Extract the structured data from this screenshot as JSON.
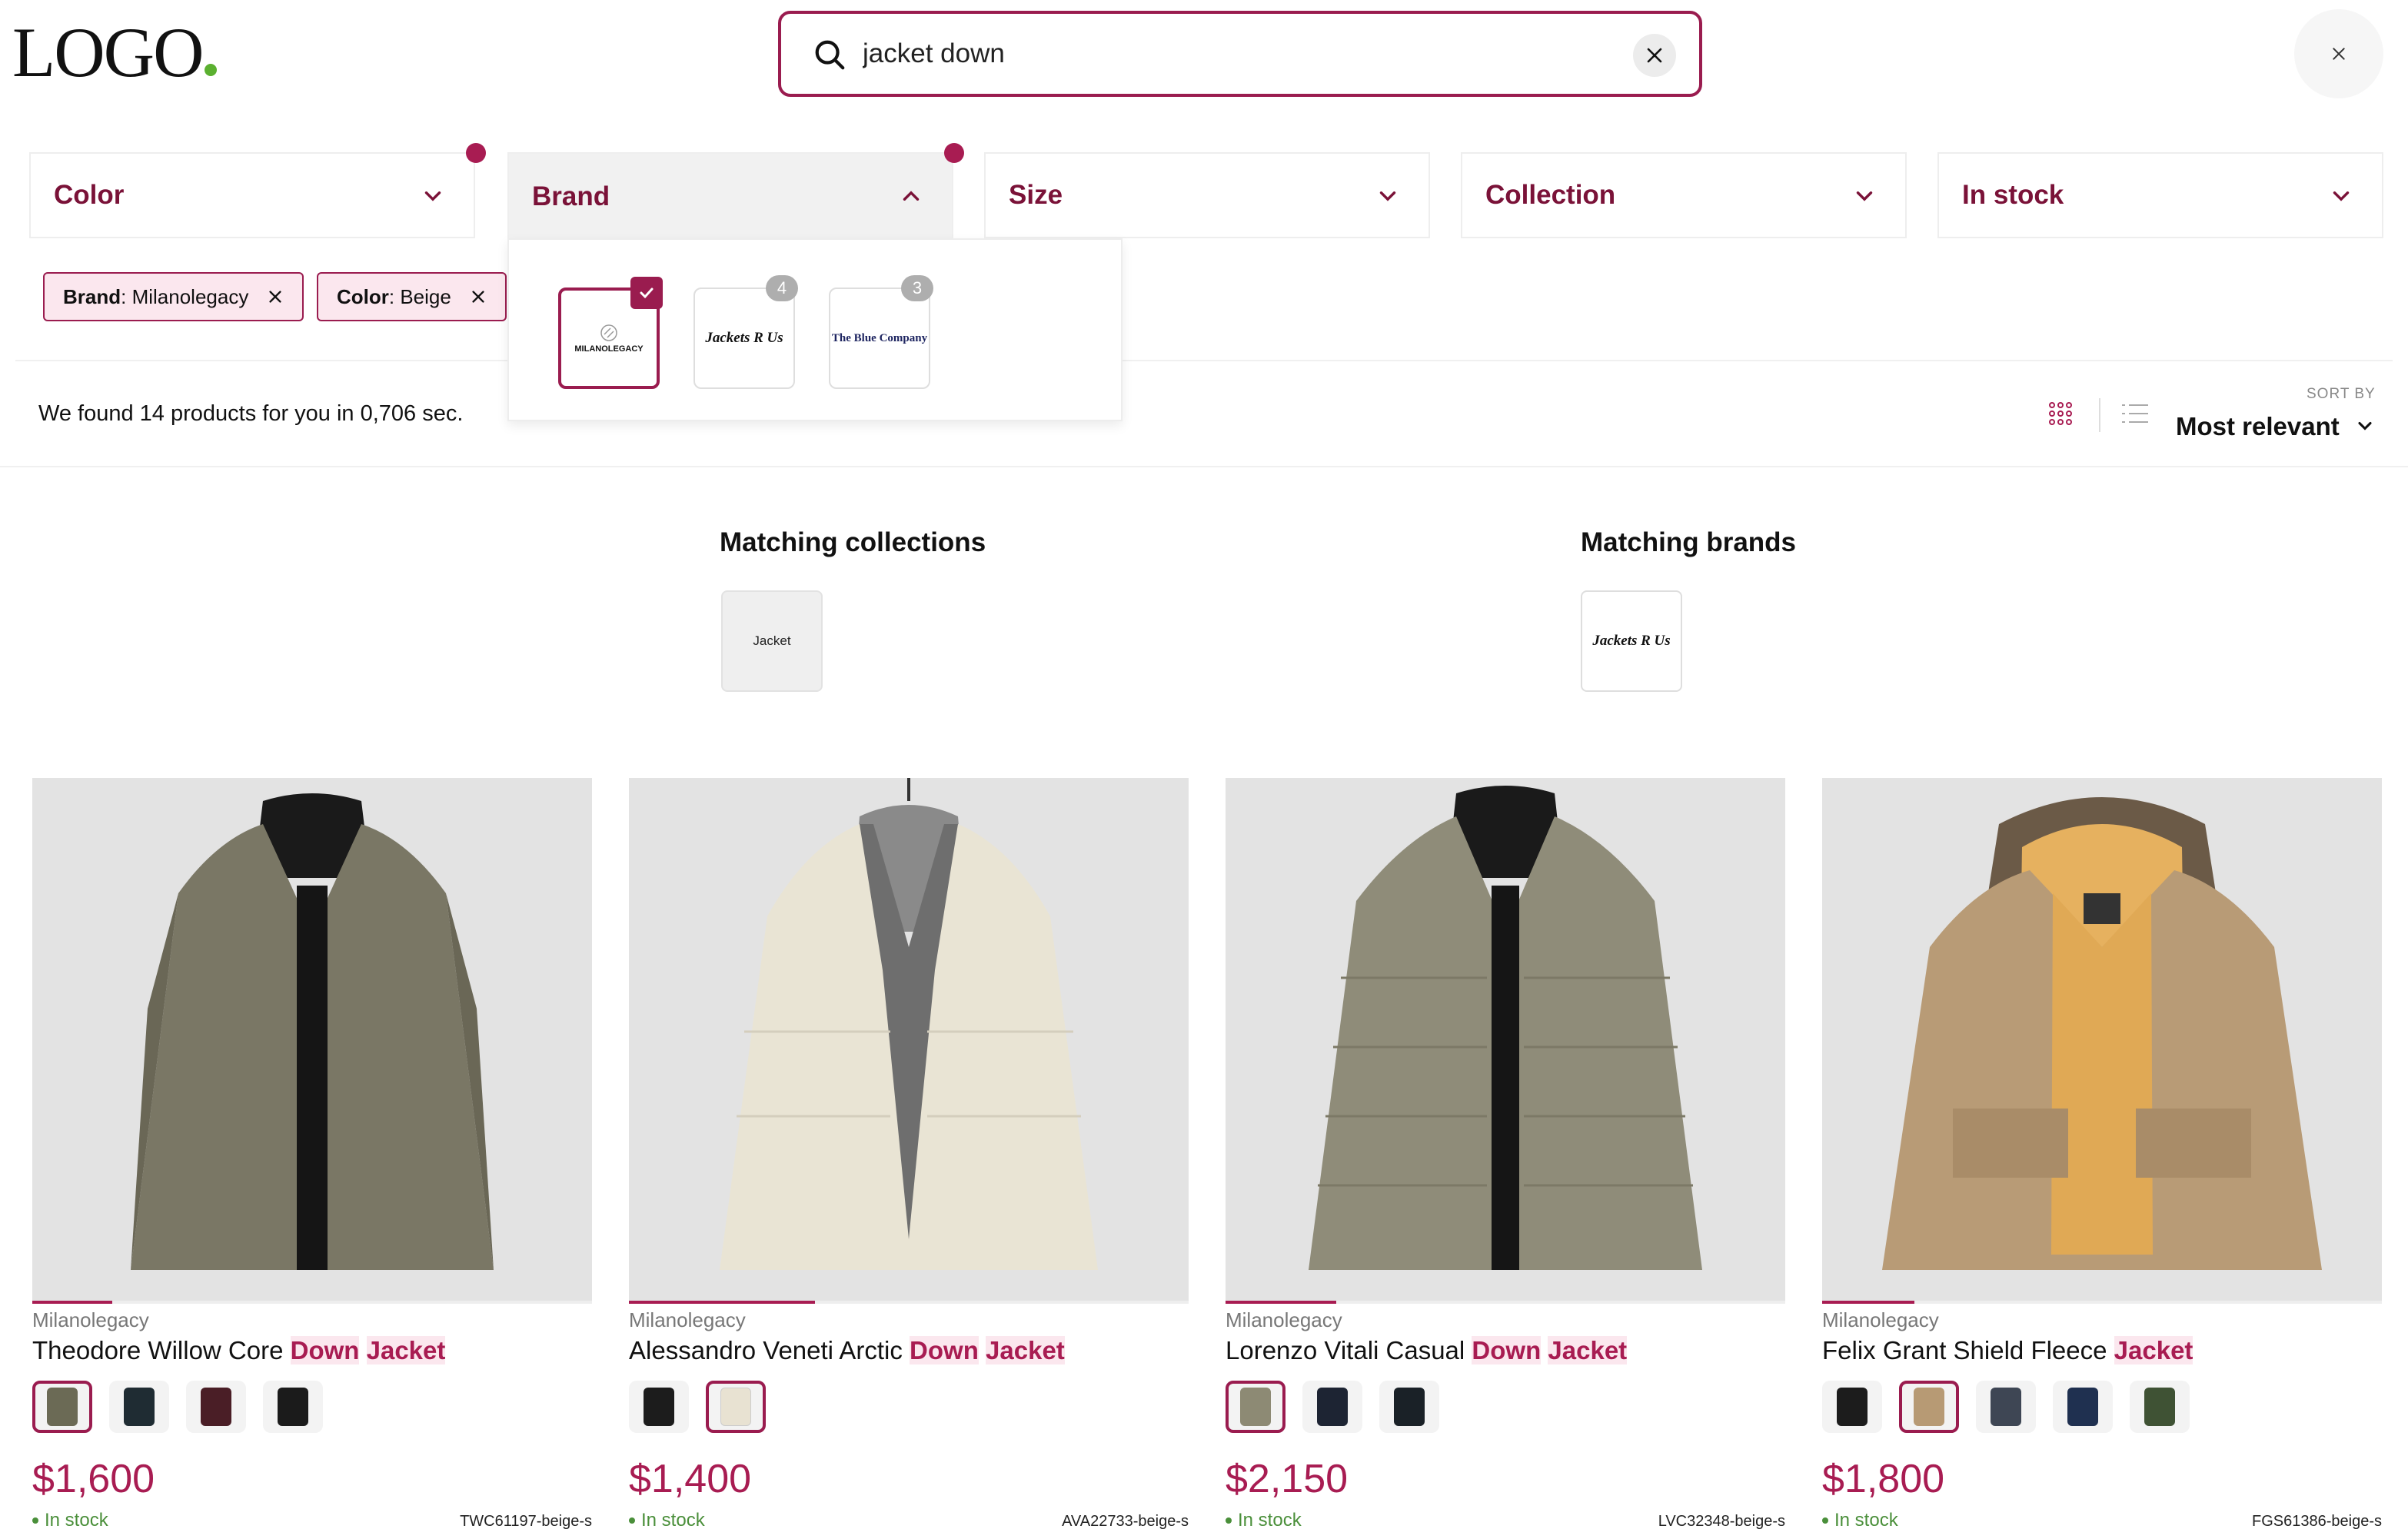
{
  "header": {
    "logo_text": "LOGO",
    "search_value": "jacket down"
  },
  "filters": [
    {
      "label": "Color",
      "active": true
    },
    {
      "label": "Brand",
      "active": true,
      "open": true
    },
    {
      "label": "Size"
    },
    {
      "label": "Collection"
    },
    {
      "label": "In stock"
    }
  ],
  "brand_panel": {
    "brands": [
      {
        "name": "MILANOLEGACY",
        "selected": true
      },
      {
        "name": "Jackets R Us",
        "count": "4"
      },
      {
        "name": "The Blue Company",
        "count": "3"
      }
    ]
  },
  "chips": [
    {
      "key": "Brand",
      "value": ": Milanolegacy"
    },
    {
      "key": "Color",
      "value": ": Beige"
    }
  ],
  "results": {
    "text": "We found 14 products for you in 0,706 sec.",
    "sort_caption": "SORT BY",
    "sort_value": "Most relevant"
  },
  "matching": {
    "collections_title": "Matching collections",
    "collection_tile": "Jacket",
    "brands_title": "Matching brands",
    "brand_tile": "Jackets R Us"
  },
  "products": [
    {
      "brand": "Milanolegacy",
      "title_plain": "Theodore Willow Core ",
      "title_hl1": "Down",
      "title_hl2": "Jacket",
      "price": "$1,600",
      "stock": "In stock",
      "sku": "TWC61197-beige-s",
      "swatches": [
        "#6b6a55",
        "#1f2c33",
        "#4a1e26",
        "#1b1b1b"
      ],
      "main_color": "#7a7765"
    },
    {
      "brand": "Milanolegacy",
      "title_plain": "Alessandro Veneti Arctic ",
      "title_hl1": "Down",
      "title_hl2": "Jacket",
      "price": "$1,400",
      "stock": "In stock",
      "sku": "AVA22733-beige-s",
      "swatches": [
        "#1c1c1c",
        "#e8e2d2"
      ],
      "main_color": "#e9e4d4"
    },
    {
      "brand": "Milanolegacy",
      "title_plain": "Lorenzo Vitali Casual ",
      "title_hl1": "Down",
      "title_hl2": "Jacket",
      "price": "$2,150",
      "stock": "In stock",
      "sku": "LVC32348-beige-s",
      "swatches": [
        "#8d8a74",
        "#1d2433",
        "#1a2127"
      ],
      "main_color": "#8f8c79"
    },
    {
      "brand": "Milanolegacy",
      "title_plain": "Felix Grant Shield Fleece ",
      "title_hl1": "",
      "title_hl2": "Jacket",
      "price": "$1,800",
      "stock": "In stock",
      "sku": "FGS61386-beige-s",
      "swatches": [
        "#1c1c1c",
        "#b79a74",
        "#3e4654",
        "#1f3050",
        "#3f5234"
      ],
      "main_color": "#b89b76"
    }
  ],
  "colors": {
    "accent": "#9a1c4f",
    "chip_bg": "#fbe7ee",
    "in_stock": "#4a8f3a"
  }
}
